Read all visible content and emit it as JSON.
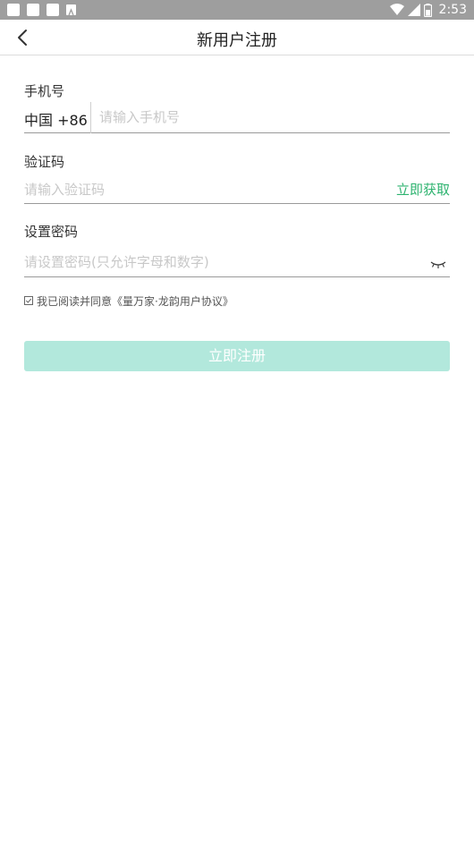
{
  "status_bar": {
    "time": "2:53",
    "icons": [
      "notification-icon",
      "notification-icon",
      "notification-icon",
      "notification-icon",
      "wifi-icon",
      "signal-icon",
      "battery-icon"
    ]
  },
  "header": {
    "title": "新用户注册",
    "back_icon": "chevron-left-icon"
  },
  "form": {
    "phone": {
      "label": "手机号",
      "country": "中国 +86",
      "placeholder": "请输入手机号",
      "value": ""
    },
    "code": {
      "label": "验证码",
      "placeholder": "请输入验证码",
      "value": "",
      "get_code_label": "立即获取"
    },
    "password": {
      "label": "设置密码",
      "placeholder": "请设置密码(只允许字母和数字)",
      "value": "",
      "eye_icon": "eye-closed-icon"
    },
    "agreement": {
      "text": "我已阅读并同意《量万家·龙韵用户协议》",
      "checked": false
    },
    "submit_label": "立即注册"
  },
  "colors": {
    "accent": "#2db36f",
    "button_disabled": "#b2e8dc",
    "status_bar": "#9e9e9e"
  }
}
